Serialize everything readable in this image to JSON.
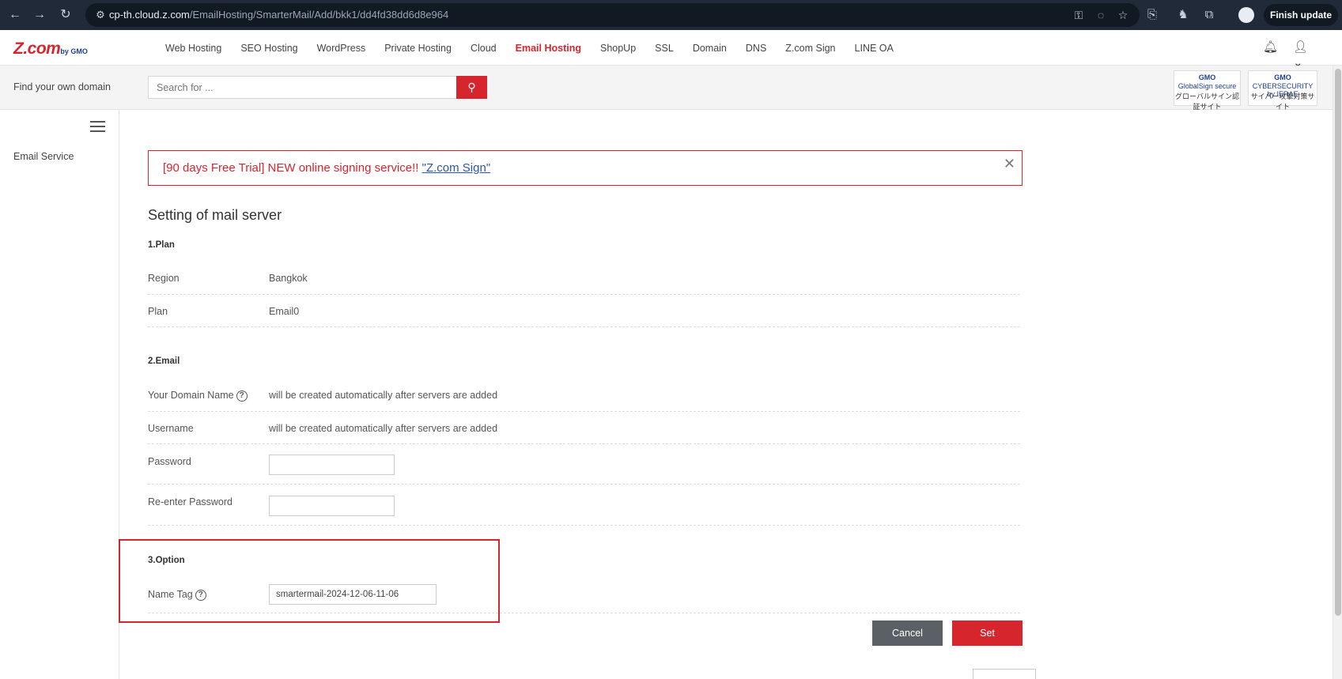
{
  "browser": {
    "url_host": "cp-th.cloud.z.com",
    "url_path": "/EmailHosting/SmarterMail/Add/bkk1/dd4fd38dd6d8e964",
    "finish_update": "Finish update"
  },
  "header": {
    "logo": "Z.com",
    "logo_sub": "by GMO",
    "menu": [
      "Web Hosting",
      "SEO Hosting",
      "WordPress",
      "Private Hosting",
      "Cloud",
      "Email Hosting",
      "ShopUp",
      "SSL",
      "Domain",
      "DNS",
      "Z.com Sign",
      "LINE OA"
    ],
    "active_menu": "Email Hosting"
  },
  "search": {
    "label": "Find your own domain",
    "placeholder": "Search for ..."
  },
  "badges": [
    {
      "l1": "GMO",
      "l2": "GlobalSign secure",
      "l3": "グローバルサイン認証サイト"
    },
    {
      "l1": "GMO",
      "l2": "CYBERSECURITY by IERAE",
      "l3": "サイバー攻撃対策サイト"
    }
  ],
  "sidebar": {
    "items": [
      "Email Service"
    ]
  },
  "alert": {
    "text": "[90 days Free Trial] NEW online signing service!! ",
    "link": "\"Z.com Sign\"",
    "close": "✕"
  },
  "page": {
    "title": "Setting of mail server",
    "plan_section": "1.Plan",
    "region_label": "Region",
    "region_value": "Bangkok",
    "plan_label": "Plan",
    "plan_value": "Email0",
    "email_section": "2.Email",
    "domain_label": "Your Domain Name",
    "domain_value": "will be created automatically after servers are added",
    "username_label": "Username",
    "username_value": "will be created automatically after servers are added",
    "password_label": "Password",
    "reenter_label": "Re-enter Password",
    "option_section": "3.Option",
    "nametag_label": "Name Tag",
    "nametag_value": "smartermail-2024-12-06-11-06",
    "cancel": "Cancel",
    "set": "Set"
  },
  "colors": {
    "brand": "#d7252d",
    "cancel_bg": "#5a6065",
    "chrome_bg": "#202a38"
  }
}
